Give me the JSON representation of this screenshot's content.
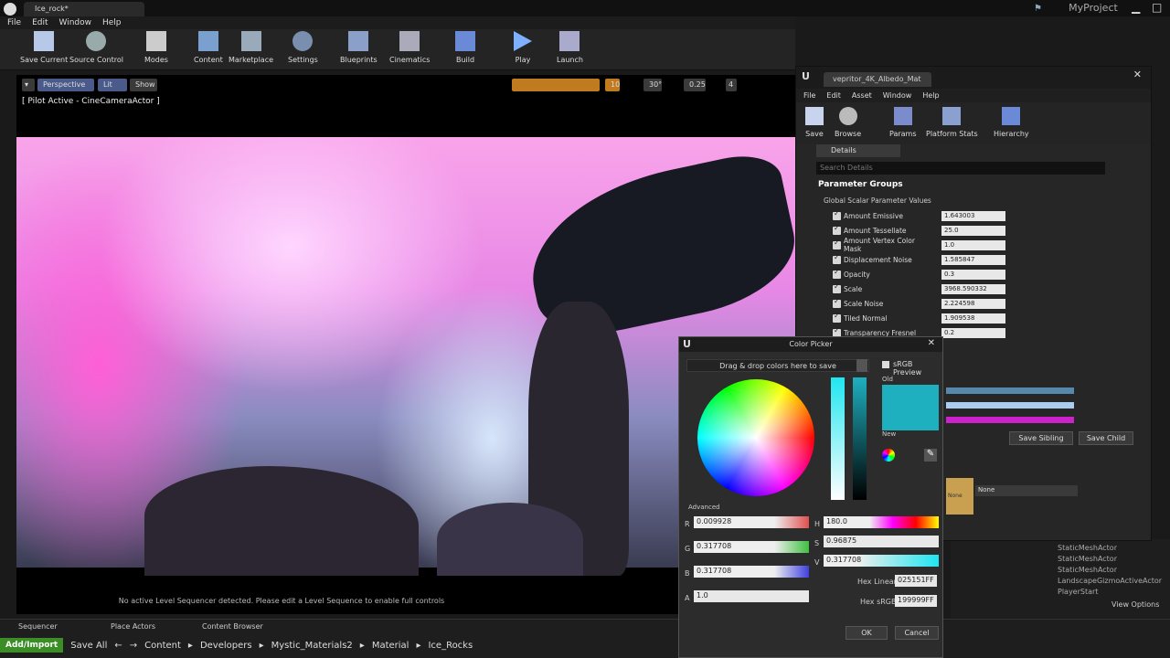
{
  "window": {
    "tab_title": "Ice_rock*",
    "project": "MyProject"
  },
  "menu": [
    "File",
    "Edit",
    "Window",
    "Help"
  ],
  "toolbar": [
    {
      "label": "Save Current",
      "icon": "save-icon"
    },
    {
      "label": "Source Control",
      "icon": "source-control-icon"
    },
    {
      "label": "Modes",
      "icon": "modes-icon"
    },
    {
      "label": "Content",
      "icon": "content-icon"
    },
    {
      "label": "Marketplace",
      "icon": "marketplace-icon"
    },
    {
      "label": "Settings",
      "icon": "settings-icon"
    },
    {
      "label": "Blueprints",
      "icon": "blueprints-icon"
    },
    {
      "label": "Cinematics",
      "icon": "cinematics-icon"
    },
    {
      "label": "Build",
      "icon": "build-icon"
    },
    {
      "label": "Play",
      "icon": "play-icon"
    },
    {
      "label": "Launch",
      "icon": "launch-icon"
    }
  ],
  "viewport": {
    "perspective": "Perspective",
    "lit": "Lit",
    "show": "Show",
    "pilot": "[ Pilot Active - CineCameraActor ]",
    "snap_grid": "10",
    "snap_rot": "30°",
    "snap_scale": "0.25",
    "cam_speed": "4",
    "sequencer_msg": "No active Level Sequencer detected. Please edit a Level Sequence to enable full controls"
  },
  "bottom_tabs": [
    "Sequencer",
    "Place Actors",
    "Content Browser"
  ],
  "content_browser": {
    "add_import": "Add/Import",
    "save_all": "Save All",
    "path": [
      "Content",
      "Developers",
      "Mystic_Materials2",
      "Material",
      "Ice_Rocks"
    ]
  },
  "outliner_items": [
    "StaticMeshActor",
    "StaticMeshActor",
    "StaticMeshActor",
    "LandscapeGizmoActiveActor",
    "PlayerStart"
  ],
  "view_options": "View Options",
  "material_window": {
    "tab_title": "vepritor_4K_Albedo_Mat",
    "menu": [
      "File",
      "Edit",
      "Asset",
      "Window",
      "Help"
    ],
    "toolbar": [
      {
        "label": "Save",
        "icon": "save-icon"
      },
      {
        "label": "Browse",
        "icon": "browse-icon"
      },
      {
        "label": "Params",
        "icon": "params-icon"
      },
      {
        "label": "Platform Stats",
        "icon": "platform-stats-icon"
      },
      {
        "label": "Hierarchy",
        "icon": "hierarchy-icon"
      }
    ],
    "details_tab": "Details",
    "search_placeholder": "Search Details",
    "param_groups": "Parameter Groups",
    "global_scalar": "Global Scalar Parameter Values",
    "params": [
      {
        "name": "Amount Emissive",
        "value": "1.643003"
      },
      {
        "name": "Amount Tessellate",
        "value": "25.0"
      },
      {
        "name": "Amount Vertex Color Mask",
        "value": "1.0"
      },
      {
        "name": "Displacement Noise",
        "value": "1.585847"
      },
      {
        "name": "Opacity",
        "value": "0.3"
      },
      {
        "name": "Scale",
        "value": "3968.590332"
      },
      {
        "name": "Scale Noise",
        "value": "2.224598"
      },
      {
        "name": "Tiled Normal",
        "value": "1.909538"
      },
      {
        "name": "Transparency Fresnel",
        "value": "0.2"
      }
    ],
    "save_sibling": "Save Sibling",
    "save_child": "Save Child",
    "parent_none": "None",
    "thumb_none": "None"
  },
  "color_picker": {
    "title": "Color Picker",
    "drag_drop": "Drag & drop colors here to save",
    "srgb_preview": "sRGB Preview",
    "old_label": "Old",
    "new_label": "New",
    "advanced": "Advanced",
    "r": "0.009928",
    "g": "0.317708",
    "b": "0.317708",
    "a": "1.0",
    "h": "180.0",
    "s": "0.96875",
    "v": "0.317708",
    "hex_linear_label": "Hex Linear",
    "hex_linear": "025151FF",
    "hex_srgb_label": "Hex sRGB",
    "hex_srgb": "199999FF",
    "ok": "OK",
    "cancel": "Cancel",
    "color": "#1fb0c0"
  }
}
